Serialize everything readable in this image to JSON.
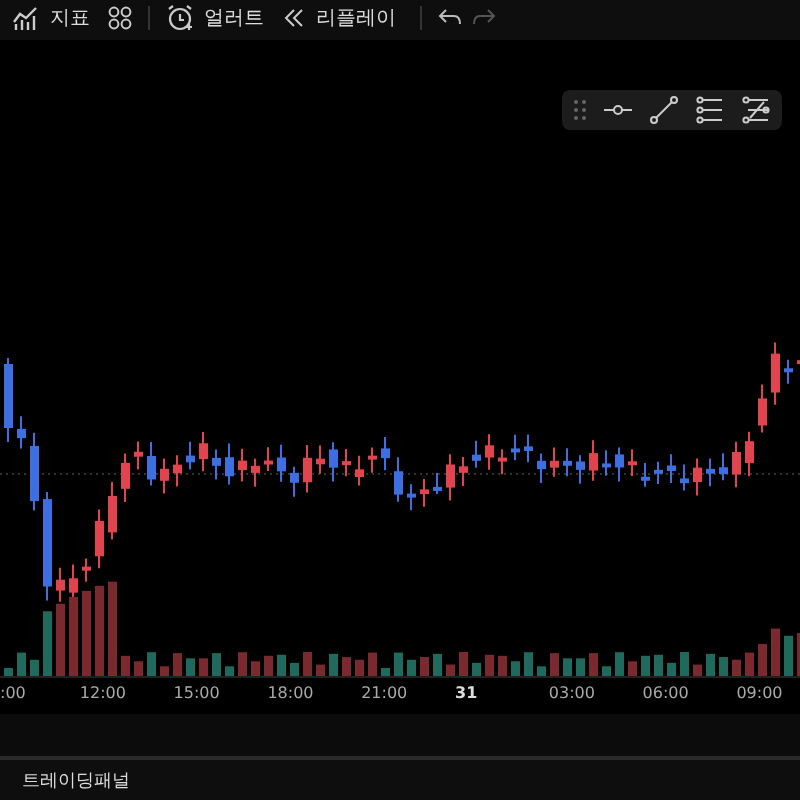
{
  "toolbar": {
    "indicators_label": "지표",
    "alert_label": "얼러트",
    "replay_label": "리플레이",
    "undo": {
      "disabled": false
    },
    "redo": {
      "disabled": true
    }
  },
  "time_axis": {
    "labels": [
      {
        "text": ":00",
        "emphasized": false
      },
      {
        "text": "12:00",
        "emphasized": false
      },
      {
        "text": "15:00",
        "emphasized": false
      },
      {
        "text": "18:00",
        "emphasized": false
      },
      {
        "text": "21:00",
        "emphasized": false
      },
      {
        "text": "31",
        "emphasized": true
      },
      {
        "text": "03:00",
        "emphasized": false
      },
      {
        "text": "06:00",
        "emphasized": false
      },
      {
        "text": "09:00",
        "emphasized": false
      }
    ]
  },
  "trading_panel": {
    "title": "트레이딩패널"
  }
}
